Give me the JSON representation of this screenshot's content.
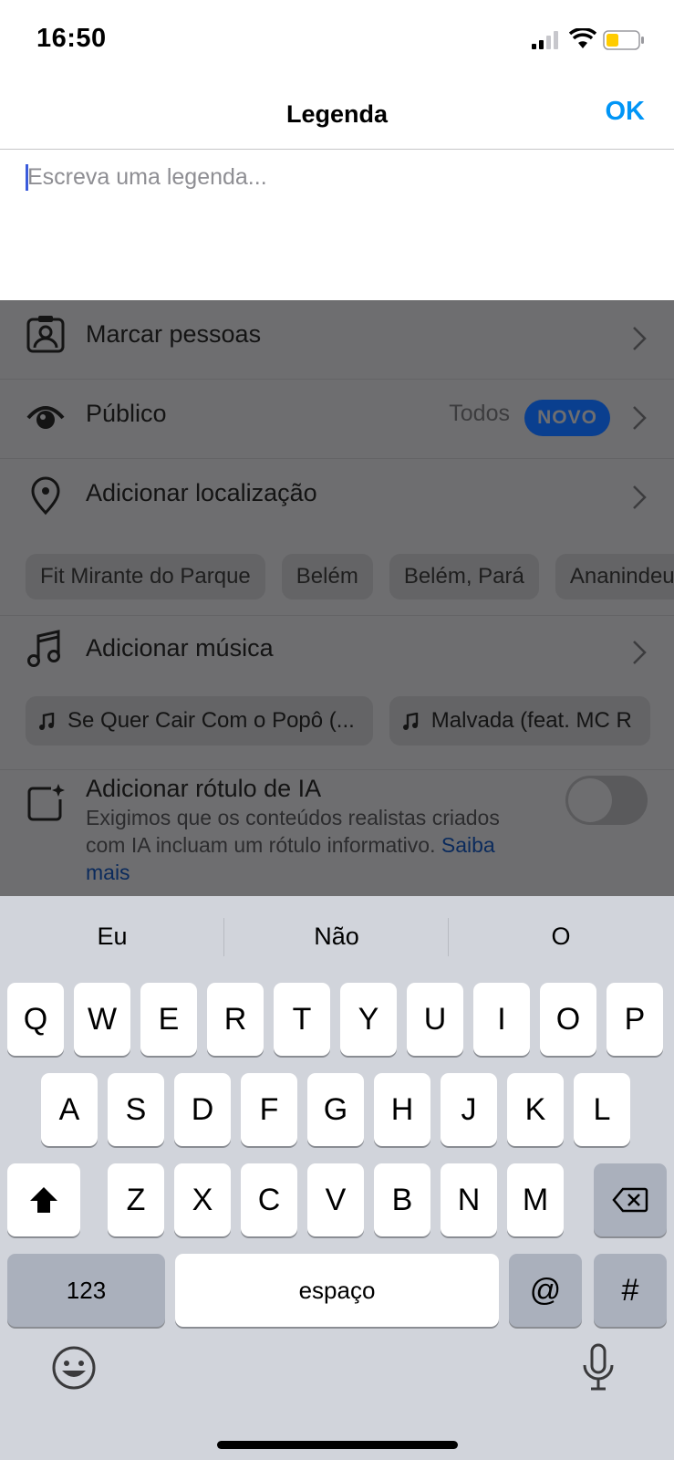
{
  "status_bar": {
    "time": "16:50",
    "battery_color": "#ffcc00"
  },
  "header": {
    "title": "Legenda",
    "ok_label": "OK",
    "accent": "#0095f6"
  },
  "caption": {
    "placeholder": "Escreva uma legenda..."
  },
  "options": {
    "tag_people": {
      "label": "Marcar pessoas",
      "icon": "person-tag-icon"
    },
    "audience": {
      "label": "Público",
      "value": "Todos",
      "badge": "NOVO",
      "icon": "eye-icon"
    },
    "location": {
      "label": "Adicionar localização",
      "icon": "location-pin-icon",
      "suggestions": [
        "Fit Mirante do Parque",
        "Belém",
        "Belém, Pará",
        "Ananindeua"
      ]
    },
    "music": {
      "label": "Adicionar música",
      "icon": "music-note-icon",
      "suggestions": [
        "Se Quer Cair Com o Popô (...",
        "Malvada (feat. MC R"
      ]
    },
    "ai_label": {
      "label": "Adicionar rótulo de IA",
      "icon": "ai-label-icon",
      "description": "Exigimos que os conteúdos realistas criados com IA incluam um rótulo informativo.",
      "link": "Saiba mais",
      "enabled": false
    }
  },
  "keyboard": {
    "suggestions": [
      "Eu",
      "Não",
      "O"
    ],
    "row1": [
      "Q",
      "W",
      "E",
      "R",
      "T",
      "Y",
      "U",
      "I",
      "O",
      "P"
    ],
    "row2": [
      "A",
      "S",
      "D",
      "F",
      "G",
      "H",
      "J",
      "K",
      "L"
    ],
    "row3": [
      "Z",
      "X",
      "C",
      "V",
      "B",
      "N",
      "M"
    ],
    "numbers_label": "123",
    "space_label": "espaço",
    "at_label": "@",
    "hash_label": "#"
  }
}
